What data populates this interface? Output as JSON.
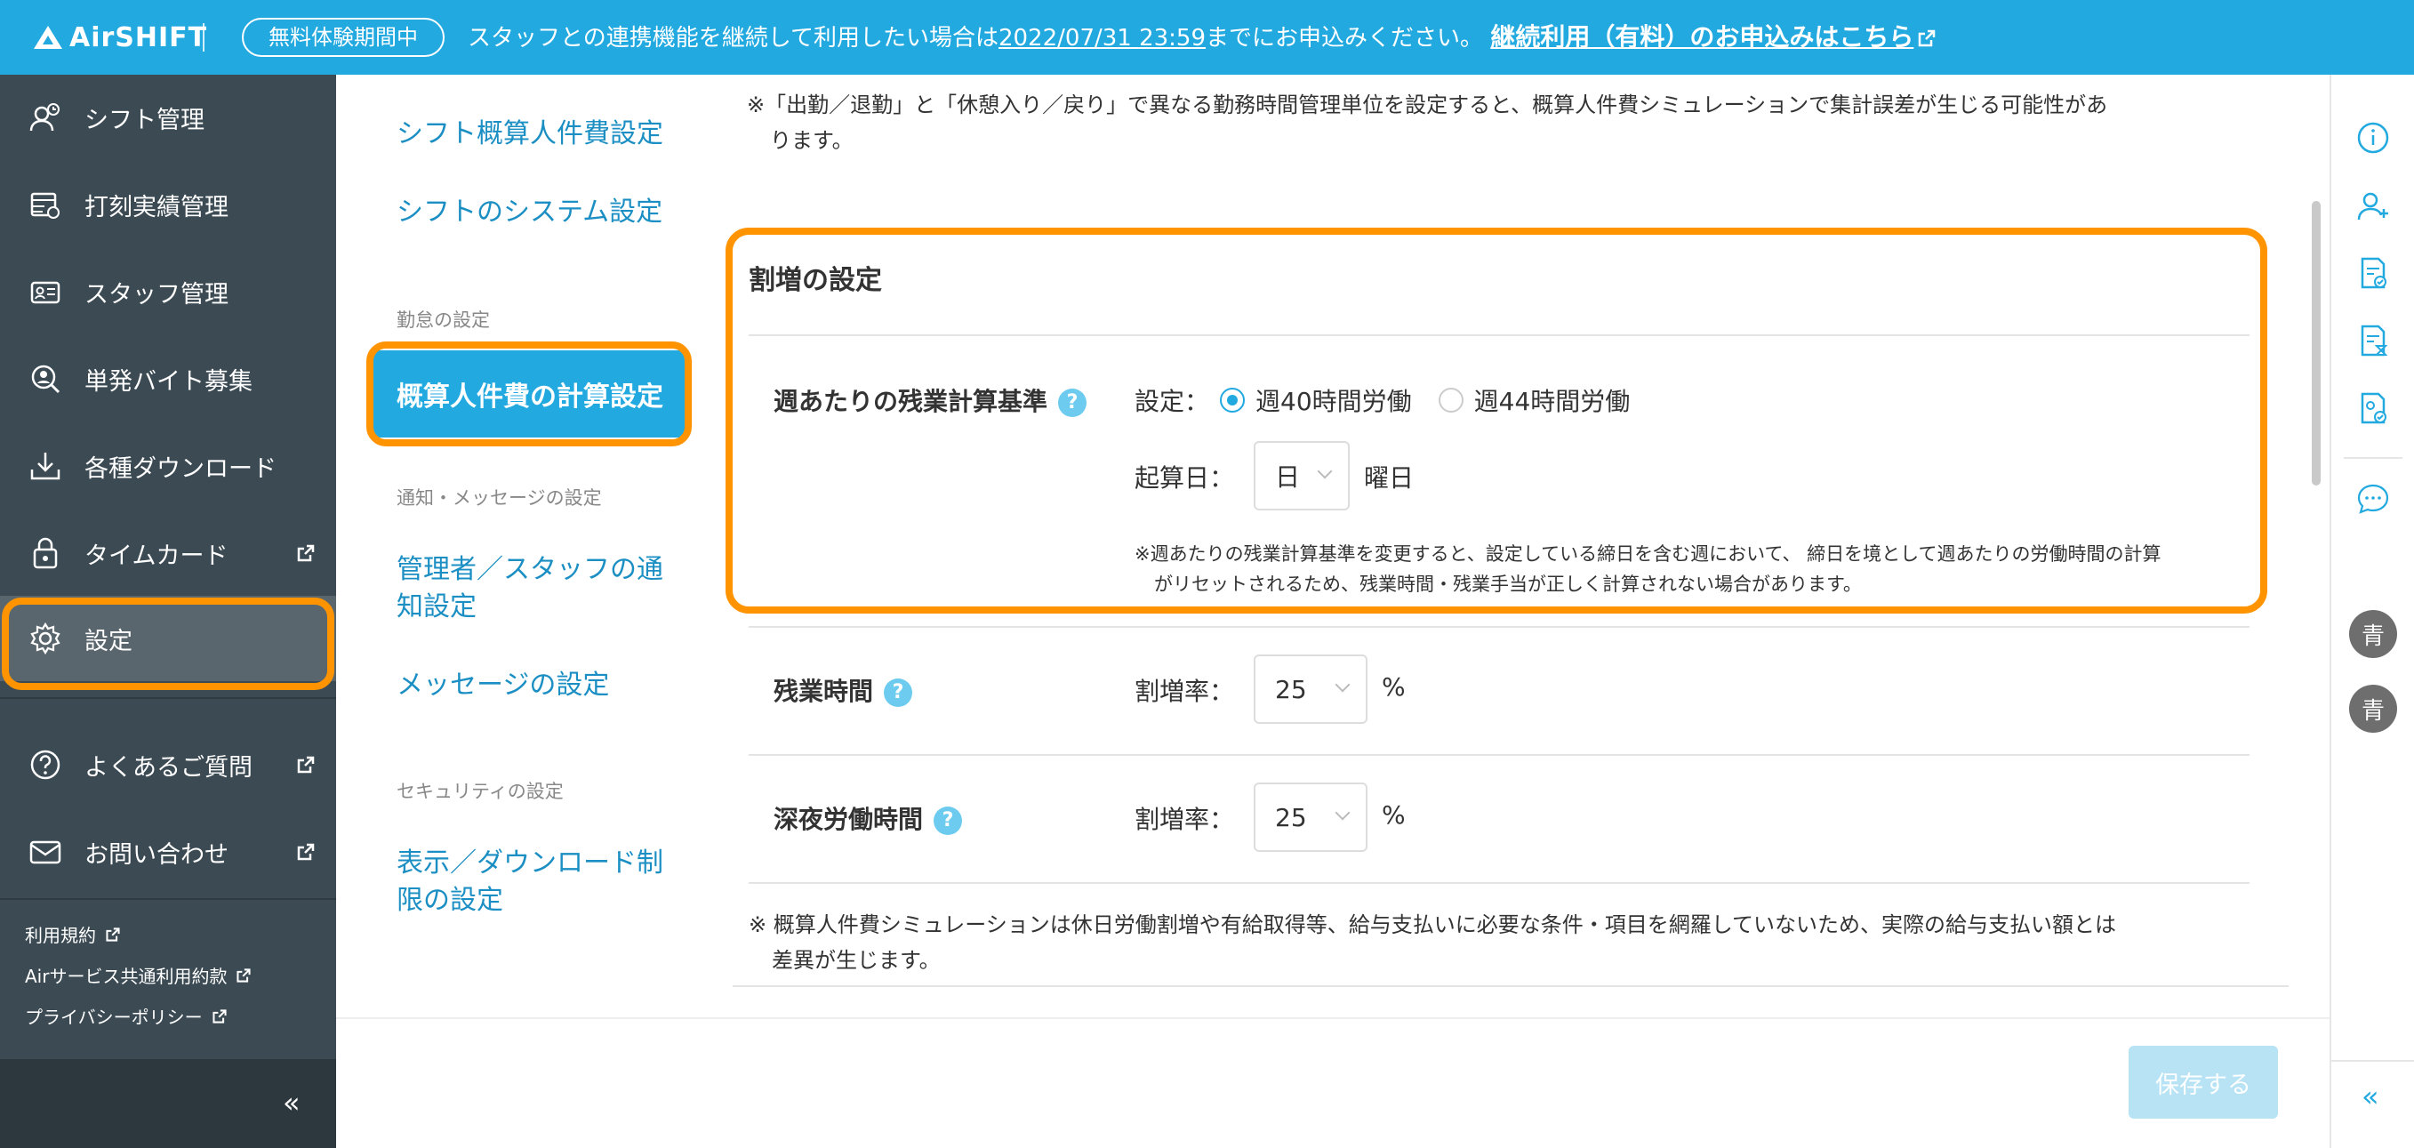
{
  "banner": {
    "logo": "AirSHIFT",
    "trial_badge": "無料体験期間中",
    "notice_prefix": "スタッフとの連携機能を継続して利用したい場合は",
    "notice_date": "2022/07/31 23:59",
    "notice_suffix": "までにお申込みください。",
    "notice_link": "継続利用（有料）のお申込みはこちら"
  },
  "sidebar": {
    "items": [
      {
        "label": "シフト管理",
        "icon": "shift-user-icon"
      },
      {
        "label": "打刻実績管理",
        "icon": "timesheet-icon"
      },
      {
        "label": "スタッフ管理",
        "icon": "staff-card-icon"
      },
      {
        "label": "単発バイト募集",
        "icon": "recruit-search-icon"
      },
      {
        "label": "各種ダウンロード",
        "icon": "download-icon"
      },
      {
        "label": "タイムカード",
        "icon": "timecard-lock-icon"
      },
      {
        "label": "設定",
        "icon": "gear-icon"
      },
      {
        "label": "よくあるご質問",
        "icon": "question-circle-icon"
      },
      {
        "label": "お問い合わせ",
        "icon": "mail-icon"
      }
    ],
    "footer_links": [
      "利用規約",
      "Airサービス共通利用約款",
      "プライバシーポリシー"
    ],
    "collapse_label": "«"
  },
  "subnav": {
    "links_top": [
      "シフト概算人件費設定",
      "シフトのシステム設定"
    ],
    "heading_attendance": "勤怠の設定",
    "active_item": "概算人件費の計算設定",
    "heading_notice": "通知・メッセージの設定",
    "link_notify_1": "管理者／スタッフの通",
    "link_notify_2": "知設定",
    "link_message": "メッセージの設定",
    "heading_security": "セキュリティの設定",
    "link_security_1": "表示／ダウンロード制",
    "link_security_2": "限の設定"
  },
  "main": {
    "top_note_1": "※「出勤／退勤」と「休憩入り／戻り」で異なる勤務時間管理単位を設定すると、概算人件費シミュレーションで集計誤差が生じる可能性があ",
    "top_note_2": "ります。",
    "section_title": "割増の設定",
    "weekly": {
      "label": "週あたりの残業計算基準",
      "setting_label": "設定：",
      "option_40": "週40時間労働",
      "option_44": "週44時間労働",
      "selected": "週40時間労働",
      "start_day_label": "起算日：",
      "start_day_value": "日",
      "start_day_suffix": "曜日",
      "note_1": "※週あたりの残業計算基準を変更すると、設定している締日を含む週において、 締日を境として週あたりの労働時間の計算",
      "note_2": "がリセットされるため、残業時間・残業手当が正しく計算されない場合があります。"
    },
    "overtime": {
      "label": "残業時間",
      "rate_label": "割増率：",
      "value": "25",
      "unit": "%"
    },
    "night": {
      "label": "深夜労働時間",
      "rate_label": "割増率：",
      "value": "25",
      "unit": "%"
    },
    "bottom_note_1": "※ 概算人件費シミュレーションは休日労働割増や有給取得等、給与支払いに必要な条件・項目を網羅していないため、実際の給与支払い額とは",
    "bottom_note_2": "差異が生じます。",
    "help_glyph": "?"
  },
  "footer": {
    "save_label": "保存する"
  },
  "rail": {
    "icons": [
      "info-icon",
      "add-user-icon",
      "doc-check-icon",
      "doc-timer-icon",
      "doc-user-check-icon",
      "chat-icon"
    ],
    "avatars": [
      "青",
      "青"
    ],
    "collapse_label": "«"
  },
  "colors": {
    "accent": "#22a9e0",
    "highlight": "#ff9400",
    "sidebar": "#3b4a53",
    "link": "#1b8fc3"
  }
}
